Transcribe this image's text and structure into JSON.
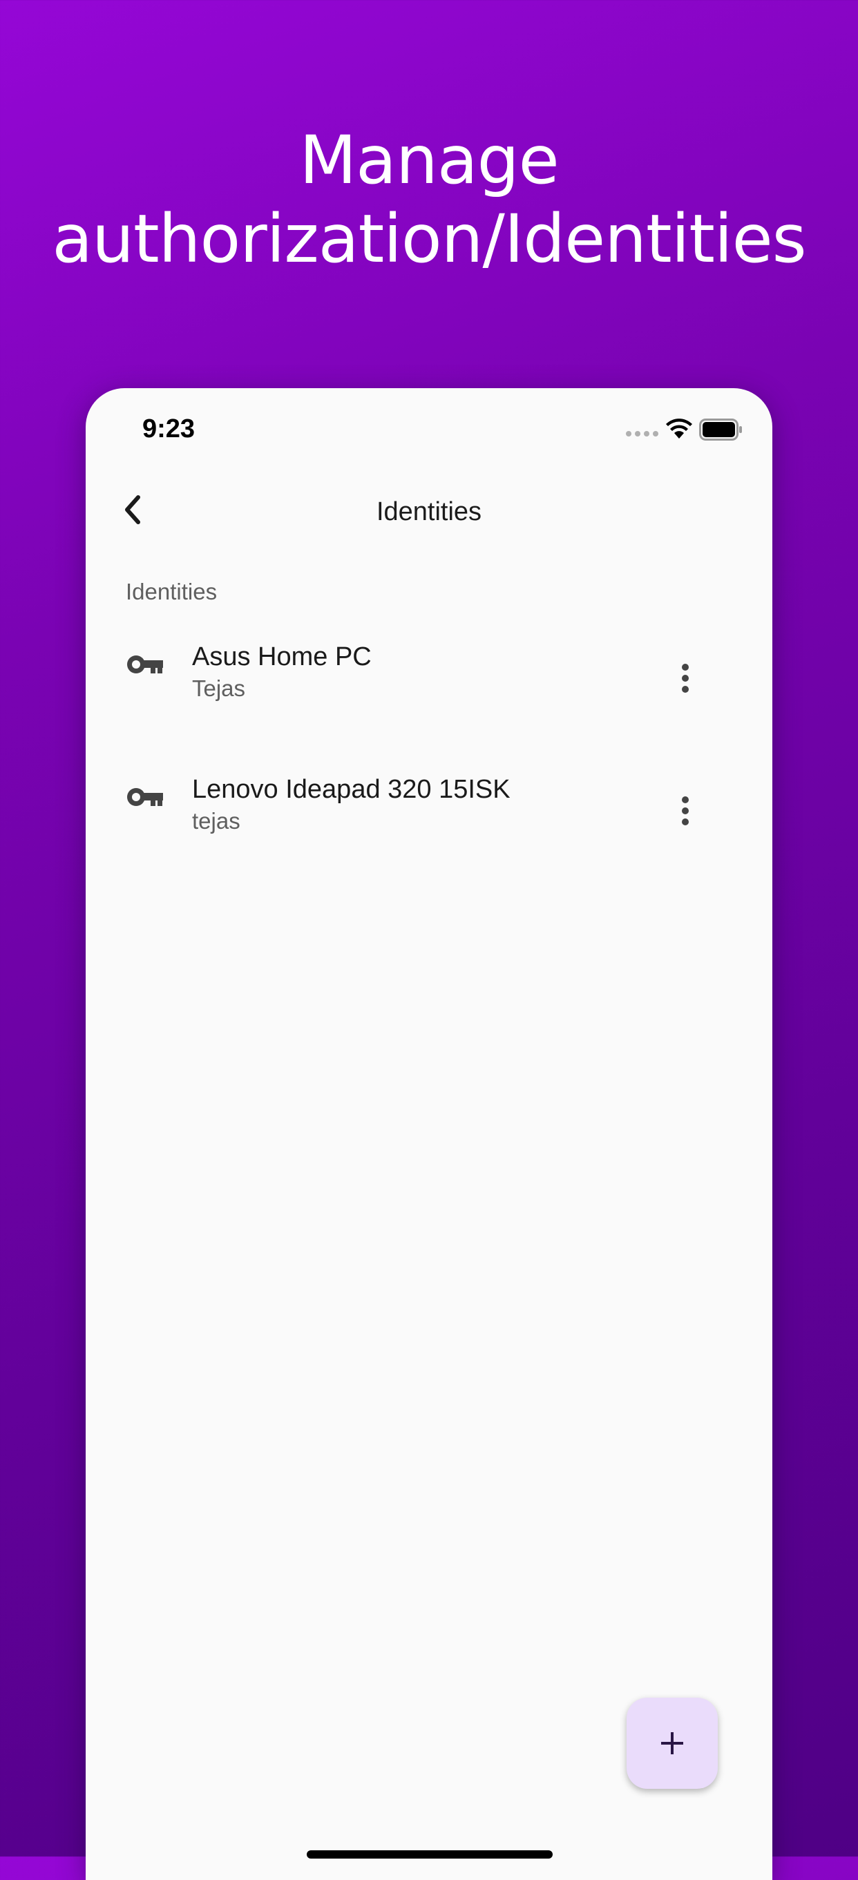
{
  "headline": {
    "line1": "Manage",
    "line2": "authorization/Identities"
  },
  "status_bar": {
    "time": "9:23",
    "icons": [
      "cellular-signal-icon",
      "wifi-icon",
      "battery-icon"
    ]
  },
  "app_bar": {
    "back_icon": "chevron-left-icon",
    "title": "Identities"
  },
  "section_header": "Identities",
  "identities": [
    {
      "icon": "key-icon",
      "name": "Asus Home PC",
      "user": "Tejas",
      "menu_icon": "more-vert-icon"
    },
    {
      "icon": "key-icon",
      "name": "Lenovo Ideapad 320 15ISK",
      "user": "tejas",
      "menu_icon": "more-vert-icon"
    }
  ],
  "fab": {
    "icon": "plus-icon"
  },
  "colors": {
    "background_gradient_start": "#9507d6",
    "background_gradient_end": "#4f0085",
    "surface": "#fafafa",
    "fab_background": "#eadcfb",
    "icon_gray": "#444444",
    "fab_icon": "#2a1645"
  }
}
